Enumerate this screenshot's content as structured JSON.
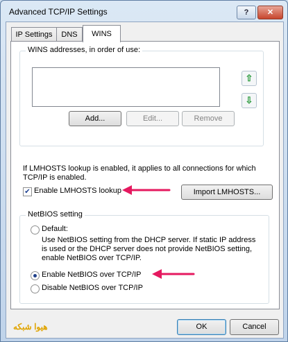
{
  "window": {
    "title": "Advanced TCP/IP Settings",
    "help_glyph": "?",
    "close_glyph": "✕"
  },
  "tabs": [
    {
      "label": "IP Settings"
    },
    {
      "label": "DNS"
    },
    {
      "label": "WINS",
      "selected": true
    }
  ],
  "wins": {
    "group_label": "WINS addresses, in order of use:",
    "addresses": [],
    "up_glyph": "⇧",
    "down_glyph": "⇩",
    "add_label": "Add...",
    "edit_label": "Edit...",
    "remove_label": "Remove"
  },
  "lmhosts": {
    "description": "If LMHOSTS lookup is enabled, it applies to all connections for which TCP/IP is enabled.",
    "checkbox_label": "Enable LMHOSTS lookup",
    "checked": true,
    "check_glyph": "✔",
    "import_label": "Import LMHOSTS..."
  },
  "netbios": {
    "group_label": "NetBIOS setting",
    "default_label": "Default:",
    "default_desc": "Use NetBIOS setting from the DHCP server. If static IP address is used or the DHCP server does not provide NetBIOS setting, enable NetBIOS over TCP/IP.",
    "enable_label": "Enable NetBIOS over TCP/IP",
    "disable_label": "Disable NetBIOS over TCP/IP",
    "selected": "enable"
  },
  "footer": {
    "ok_label": "OK",
    "cancel_label": "Cancel",
    "watermark": "هیوا شبکه"
  },
  "colors": {
    "annotation_arrow": "#e5195f",
    "accent": "#1f3f89"
  }
}
